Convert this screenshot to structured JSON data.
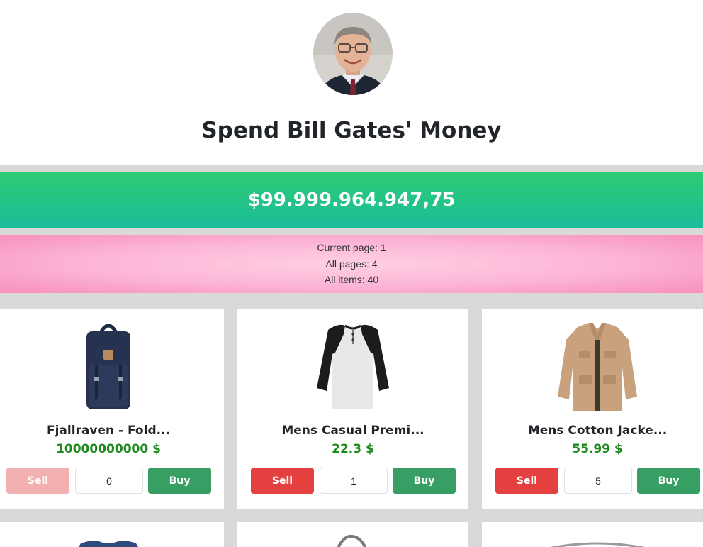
{
  "header": {
    "title": "Spend Bill Gates' Money",
    "avatar_icon": "bill-gates-portrait"
  },
  "balance": {
    "amount": "$99.999.964.947,75",
    "colors": {
      "from": "#2ecc71",
      "to": "#1abc9c"
    }
  },
  "pagination": {
    "current_page": "Current page: 1",
    "all_pages": "All pages: 4",
    "all_items": "All items: 40"
  },
  "products": [
    {
      "name": "Fjallraven - Fold...",
      "price": "10000000000 $",
      "sell_label": "Sell",
      "buy_label": "Buy",
      "quantity": "0",
      "sell_disabled": true,
      "icon": "backpack-icon"
    },
    {
      "name": "Mens Casual Premi...",
      "price": "22.3 $",
      "sell_label": "Sell",
      "buy_label": "Buy",
      "quantity": "1",
      "sell_disabled": false,
      "icon": "raglan-shirt-icon"
    },
    {
      "name": "Mens Cotton Jacke...",
      "price": "55.99 $",
      "sell_label": "Sell",
      "buy_label": "Buy",
      "quantity": "5",
      "sell_disabled": false,
      "icon": "cotton-jacket-icon"
    }
  ],
  "colors": {
    "sell": "#e3403f",
    "sell_disabled": "#f3b0b0",
    "buy": "#379f63",
    "price": "#1e8a1e",
    "background_gap": "#d9d9d9"
  }
}
